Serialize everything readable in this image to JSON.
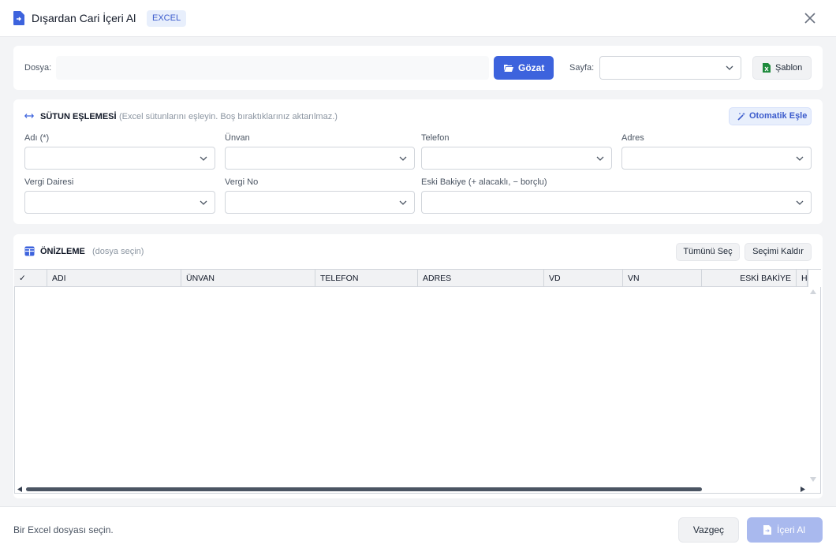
{
  "window": {
    "title": "Dışardan Cari İçeri Al",
    "badge": "EXCEL"
  },
  "file_row": {
    "file_label": "Dosya:",
    "file_value": "",
    "browse_label": "Gözat",
    "sheet_label": "Sayfa:",
    "sheet_value": "",
    "template_label": "Şablon"
  },
  "mapping": {
    "title": "SÜTUN EŞLEMESİ",
    "hint": "(Excel sütunlarını eşleyin. Boş bıraktıklarınız aktarılmaz.)",
    "auto_label": "Otomatik Eşle",
    "fields": [
      {
        "label": "Adı  (*)",
        "value": ""
      },
      {
        "label": "Ünvan",
        "value": ""
      },
      {
        "label": "Telefon",
        "value": ""
      },
      {
        "label": "Adres",
        "value": ""
      },
      {
        "label": "Vergi Dairesi",
        "value": ""
      },
      {
        "label": "Vergi No",
        "value": ""
      },
      {
        "label": "Eski Bakiye  (+ alacaklı,  − borçlu)",
        "value": ""
      }
    ]
  },
  "preview": {
    "title": "ÖNİZLEME",
    "hint": "(dosya seçin)",
    "select_all_label": "Tümünü Seç",
    "clear_selection_label": "Seçimi Kaldır",
    "columns": [
      "✓",
      "ADI",
      "ÜNVAN",
      "TELEFON",
      "ADRES",
      "VD",
      "VN",
      "ESKİ BAKİYE",
      "H"
    ],
    "rows": []
  },
  "footer": {
    "status": "Bir Excel dosyası seçin.",
    "cancel_label": "Vazgeç",
    "import_label": "İçeri Al"
  },
  "colors": {
    "primary": "#3d63dd",
    "primary_disabled": "#a9b9ee",
    "excel_green": "#1e8a3c",
    "background": "#f3f4f6"
  }
}
